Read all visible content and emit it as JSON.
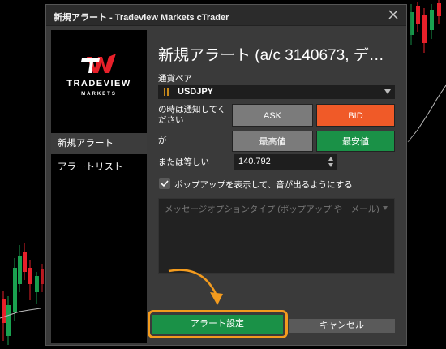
{
  "window": {
    "title": "新規アラート - Tradeview Markets cTrader"
  },
  "logo": {
    "brand": "TRADEVIEW",
    "sub": "MARKETS",
    "mark": "W"
  },
  "sidebar": {
    "items": [
      {
        "label": "新規アラート",
        "active": true
      },
      {
        "label": "アラートリスト",
        "active": false
      }
    ]
  },
  "main": {
    "heading": "新規アラート (a/c 3140673, デ…",
    "pair_label": "通貨ペア",
    "pair_value": "USDJPY",
    "condition_label": "の時は通知してください",
    "ask_label": "ASK",
    "bid_label": "BID",
    "direction_label": "が",
    "high_label": "最高値",
    "low_label": "最安値",
    "price_label": "または等しい",
    "price_value": "140.792",
    "popup_checkbox_label": "ポップアップを表示して、音が出るようにする",
    "popup_checked": true,
    "message_placeholder": "メッセージオプションタイプ (ポップアップ や　メール)",
    "create_button": "アラート設定",
    "cancel_button": "キャンセル"
  },
  "colors": {
    "bid": "#f05a28",
    "green": "#1a9147",
    "highlight": "#f39b1e",
    "brand_red": "#e8202a"
  }
}
